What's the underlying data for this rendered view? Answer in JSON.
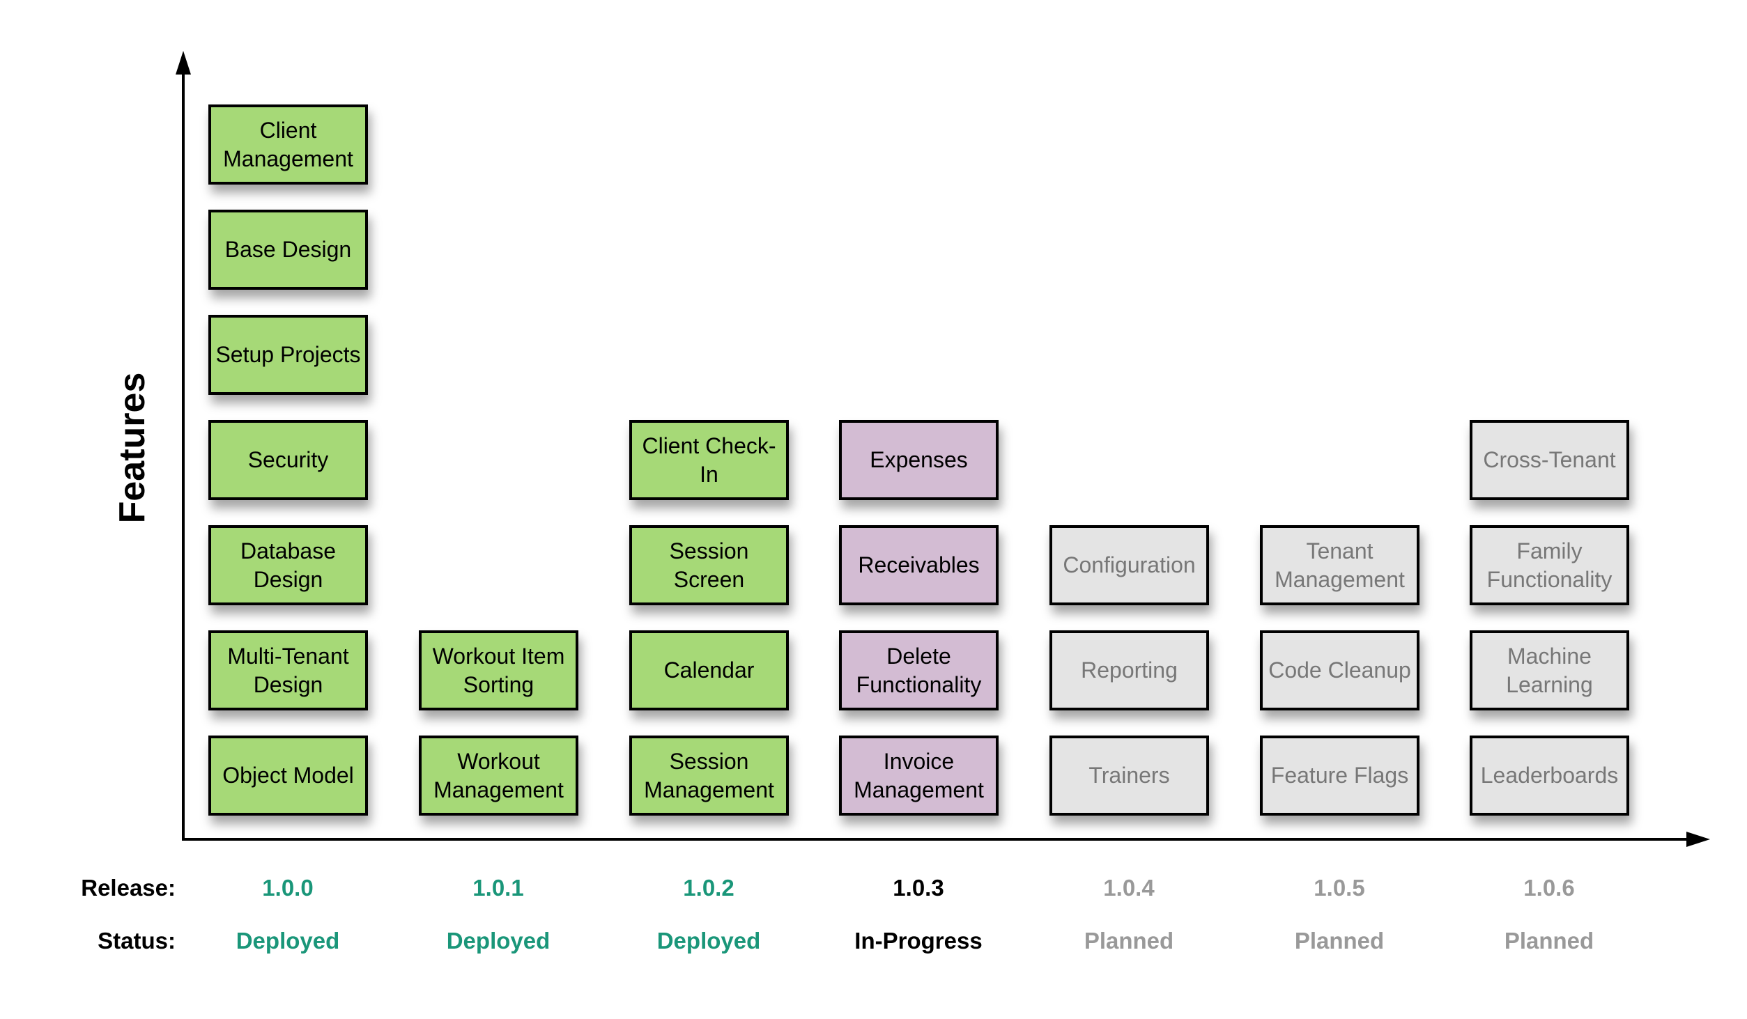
{
  "axis": {
    "y_title": "Features"
  },
  "labels": {
    "release": "Release:",
    "status": "Status:"
  },
  "status_styles": {
    "Deployed": {
      "fill": "#a6d977",
      "text": "#000000",
      "label": "#1a9679"
    },
    "In-Progress": {
      "fill": "#d3bcd3",
      "text": "#000000",
      "label": "#000000"
    },
    "Planned": {
      "fill": "#e4e4e4",
      "text": "#777777",
      "label": "#999999"
    }
  },
  "releases": [
    {
      "version": "1.0.0",
      "status": "Deployed",
      "features": [
        "Object Model",
        "Multi-Tenant Design",
        "Database Design",
        "Security",
        "Setup Projects",
        "Base Design",
        "Client Management"
      ]
    },
    {
      "version": "1.0.1",
      "status": "Deployed",
      "features": [
        "Workout Management",
        "Workout Item Sorting"
      ]
    },
    {
      "version": "1.0.2",
      "status": "Deployed",
      "features": [
        "Session Management",
        "Calendar",
        "Session Screen",
        "Client Check-In"
      ]
    },
    {
      "version": "1.0.3",
      "status": "In-Progress",
      "features": [
        "Invoice Management",
        "Delete Functionality",
        "Receivables",
        "Expenses"
      ]
    },
    {
      "version": "1.0.4",
      "status": "Planned",
      "features": [
        "Trainers",
        "Reporting",
        "Configuration"
      ]
    },
    {
      "version": "1.0.5",
      "status": "Planned",
      "features": [
        "Feature Flags",
        "Code Cleanup",
        "Tenant Management"
      ]
    },
    {
      "version": "1.0.6",
      "status": "Planned",
      "features": [
        "Leaderboards",
        "Machine Learning",
        "Family Functionality",
        "Cross-Tenant"
      ]
    }
  ]
}
